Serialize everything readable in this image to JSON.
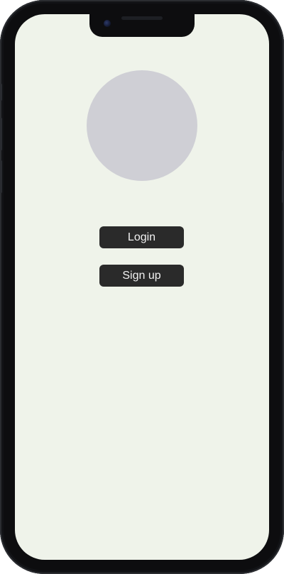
{
  "app": {
    "avatar_color": "#cfcfd5",
    "screen_background": "#eff3ea",
    "button_color": "#2a2a2a",
    "button_text_color": "#f2f2f2"
  },
  "actions": {
    "login_label": "Login",
    "signup_label": "Sign up"
  }
}
